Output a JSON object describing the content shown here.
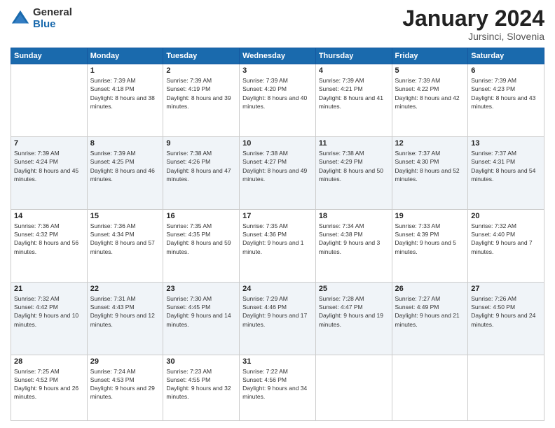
{
  "logo": {
    "general": "General",
    "blue": "Blue"
  },
  "title": {
    "month": "January 2024",
    "location": "Jursinci, Slovenia"
  },
  "weekdays": [
    "Sunday",
    "Monday",
    "Tuesday",
    "Wednesday",
    "Thursday",
    "Friday",
    "Saturday"
  ],
  "weeks": [
    [
      {
        "day": "",
        "sunrise": "",
        "sunset": "",
        "daylight": ""
      },
      {
        "day": "1",
        "sunrise": "Sunrise: 7:39 AM",
        "sunset": "Sunset: 4:18 PM",
        "daylight": "Daylight: 8 hours and 38 minutes."
      },
      {
        "day": "2",
        "sunrise": "Sunrise: 7:39 AM",
        "sunset": "Sunset: 4:19 PM",
        "daylight": "Daylight: 8 hours and 39 minutes."
      },
      {
        "day": "3",
        "sunrise": "Sunrise: 7:39 AM",
        "sunset": "Sunset: 4:20 PM",
        "daylight": "Daylight: 8 hours and 40 minutes."
      },
      {
        "day": "4",
        "sunrise": "Sunrise: 7:39 AM",
        "sunset": "Sunset: 4:21 PM",
        "daylight": "Daylight: 8 hours and 41 minutes."
      },
      {
        "day": "5",
        "sunrise": "Sunrise: 7:39 AM",
        "sunset": "Sunset: 4:22 PM",
        "daylight": "Daylight: 8 hours and 42 minutes."
      },
      {
        "day": "6",
        "sunrise": "Sunrise: 7:39 AM",
        "sunset": "Sunset: 4:23 PM",
        "daylight": "Daylight: 8 hours and 43 minutes."
      }
    ],
    [
      {
        "day": "7",
        "sunrise": "Sunrise: 7:39 AM",
        "sunset": "Sunset: 4:24 PM",
        "daylight": "Daylight: 8 hours and 45 minutes."
      },
      {
        "day": "8",
        "sunrise": "Sunrise: 7:39 AM",
        "sunset": "Sunset: 4:25 PM",
        "daylight": "Daylight: 8 hours and 46 minutes."
      },
      {
        "day": "9",
        "sunrise": "Sunrise: 7:38 AM",
        "sunset": "Sunset: 4:26 PM",
        "daylight": "Daylight: 8 hours and 47 minutes."
      },
      {
        "day": "10",
        "sunrise": "Sunrise: 7:38 AM",
        "sunset": "Sunset: 4:27 PM",
        "daylight": "Daylight: 8 hours and 49 minutes."
      },
      {
        "day": "11",
        "sunrise": "Sunrise: 7:38 AM",
        "sunset": "Sunset: 4:29 PM",
        "daylight": "Daylight: 8 hours and 50 minutes."
      },
      {
        "day": "12",
        "sunrise": "Sunrise: 7:37 AM",
        "sunset": "Sunset: 4:30 PM",
        "daylight": "Daylight: 8 hours and 52 minutes."
      },
      {
        "day": "13",
        "sunrise": "Sunrise: 7:37 AM",
        "sunset": "Sunset: 4:31 PM",
        "daylight": "Daylight: 8 hours and 54 minutes."
      }
    ],
    [
      {
        "day": "14",
        "sunrise": "Sunrise: 7:36 AM",
        "sunset": "Sunset: 4:32 PM",
        "daylight": "Daylight: 8 hours and 56 minutes."
      },
      {
        "day": "15",
        "sunrise": "Sunrise: 7:36 AM",
        "sunset": "Sunset: 4:34 PM",
        "daylight": "Daylight: 8 hours and 57 minutes."
      },
      {
        "day": "16",
        "sunrise": "Sunrise: 7:35 AM",
        "sunset": "Sunset: 4:35 PM",
        "daylight": "Daylight: 8 hours and 59 minutes."
      },
      {
        "day": "17",
        "sunrise": "Sunrise: 7:35 AM",
        "sunset": "Sunset: 4:36 PM",
        "daylight": "Daylight: 9 hours and 1 minute."
      },
      {
        "day": "18",
        "sunrise": "Sunrise: 7:34 AM",
        "sunset": "Sunset: 4:38 PM",
        "daylight": "Daylight: 9 hours and 3 minutes."
      },
      {
        "day": "19",
        "sunrise": "Sunrise: 7:33 AM",
        "sunset": "Sunset: 4:39 PM",
        "daylight": "Daylight: 9 hours and 5 minutes."
      },
      {
        "day": "20",
        "sunrise": "Sunrise: 7:32 AM",
        "sunset": "Sunset: 4:40 PM",
        "daylight": "Daylight: 9 hours and 7 minutes."
      }
    ],
    [
      {
        "day": "21",
        "sunrise": "Sunrise: 7:32 AM",
        "sunset": "Sunset: 4:42 PM",
        "daylight": "Daylight: 9 hours and 10 minutes."
      },
      {
        "day": "22",
        "sunrise": "Sunrise: 7:31 AM",
        "sunset": "Sunset: 4:43 PM",
        "daylight": "Daylight: 9 hours and 12 minutes."
      },
      {
        "day": "23",
        "sunrise": "Sunrise: 7:30 AM",
        "sunset": "Sunset: 4:45 PM",
        "daylight": "Daylight: 9 hours and 14 minutes."
      },
      {
        "day": "24",
        "sunrise": "Sunrise: 7:29 AM",
        "sunset": "Sunset: 4:46 PM",
        "daylight": "Daylight: 9 hours and 17 minutes."
      },
      {
        "day": "25",
        "sunrise": "Sunrise: 7:28 AM",
        "sunset": "Sunset: 4:47 PM",
        "daylight": "Daylight: 9 hours and 19 minutes."
      },
      {
        "day": "26",
        "sunrise": "Sunrise: 7:27 AM",
        "sunset": "Sunset: 4:49 PM",
        "daylight": "Daylight: 9 hours and 21 minutes."
      },
      {
        "day": "27",
        "sunrise": "Sunrise: 7:26 AM",
        "sunset": "Sunset: 4:50 PM",
        "daylight": "Daylight: 9 hours and 24 minutes."
      }
    ],
    [
      {
        "day": "28",
        "sunrise": "Sunrise: 7:25 AM",
        "sunset": "Sunset: 4:52 PM",
        "daylight": "Daylight: 9 hours and 26 minutes."
      },
      {
        "day": "29",
        "sunrise": "Sunrise: 7:24 AM",
        "sunset": "Sunset: 4:53 PM",
        "daylight": "Daylight: 9 hours and 29 minutes."
      },
      {
        "day": "30",
        "sunrise": "Sunrise: 7:23 AM",
        "sunset": "Sunset: 4:55 PM",
        "daylight": "Daylight: 9 hours and 32 minutes."
      },
      {
        "day": "31",
        "sunrise": "Sunrise: 7:22 AM",
        "sunset": "Sunset: 4:56 PM",
        "daylight": "Daylight: 9 hours and 34 minutes."
      },
      {
        "day": "",
        "sunrise": "",
        "sunset": "",
        "daylight": ""
      },
      {
        "day": "",
        "sunrise": "",
        "sunset": "",
        "daylight": ""
      },
      {
        "day": "",
        "sunrise": "",
        "sunset": "",
        "daylight": ""
      }
    ]
  ]
}
